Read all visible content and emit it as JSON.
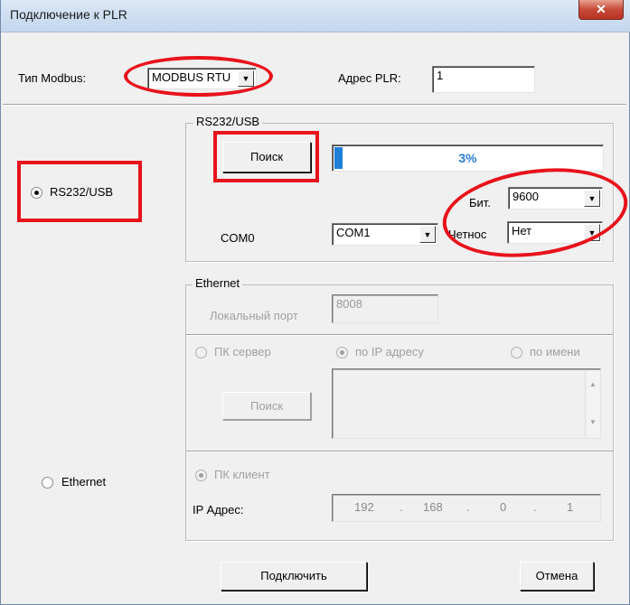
{
  "window": {
    "title": "Подключение к PLR",
    "close_glyph": "✕"
  },
  "modbus": {
    "label": "Тип Modbus:",
    "value": "MODBUS RTU"
  },
  "address": {
    "label": "Адрес PLR:",
    "value": "1"
  },
  "rs232": {
    "radio_label": "RS232/USB",
    "group_label": "RS232/USB",
    "search_label": "Поиск",
    "progress_text": "3%",
    "progress_value": 0.03,
    "bit_label": "Бит.",
    "bit_value": "9600",
    "com_label": "COM0",
    "com_value": "COM1",
    "parity_label": "Четнос",
    "parity_value": "Нет"
  },
  "ethernet": {
    "radio_label": "Ethernet",
    "group_label": "Ethernet",
    "local_port_label": "Локальный порт",
    "local_port_value": "8008",
    "pc_server_label": "ПК сервер",
    "by_ip_label": "по IP адресу",
    "by_name_label": "по имени",
    "search_label": "Поиск",
    "pc_client_label": "ПК клиент",
    "ip_label": "IP Адрес:",
    "ip": [
      "192",
      "168",
      "0",
      "1"
    ],
    "ip_dot": "."
  },
  "footer": {
    "connect_label": "Подключить",
    "cancel_label": "Отмена"
  },
  "colors": {
    "annotation_red": "#e8121b",
    "progress_blue": "#1e7fd6",
    "progress_text": "#2a7fd4"
  }
}
